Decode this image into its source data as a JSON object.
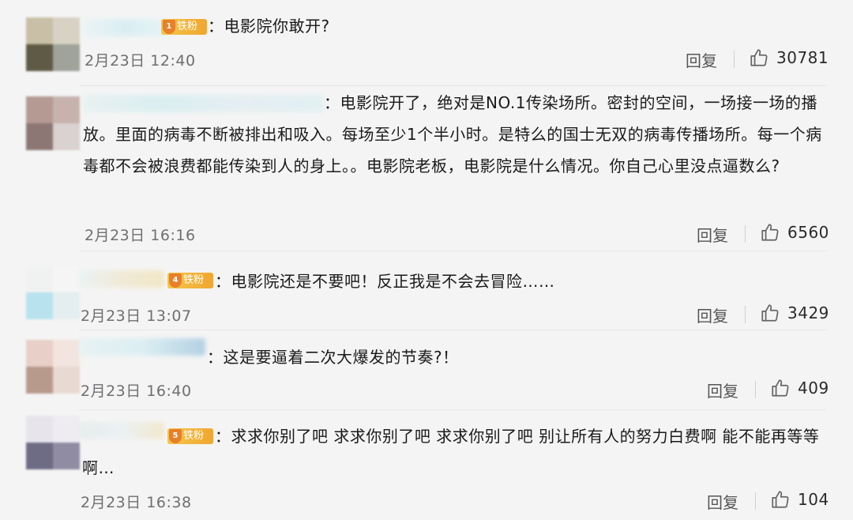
{
  "comments": [
    {
      "badge": "铁粉",
      "level": "1",
      "text": "：电影院你敢开?",
      "time": "2月23日 12:40",
      "reply": "回复",
      "likes": "30781"
    },
    {
      "badge": "",
      "level": "",
      "text": "：电影院开了，绝对是NO.1传染场所。密封的空间，一场接一场的播放。里面的病毒不断被排出和吸入。每场至少1个半小时。是特么的国士无双的病毒传播场所。每一个病毒都不会被浪费都能传染到人的身上。。电影院老板，电影院是什么情况。你自己心里没点逼数么?",
      "time": "2月23日 16:16",
      "reply": "回复",
      "likes": "6560"
    },
    {
      "badge": "铁粉",
      "level": "4",
      "text": "：电影院还是不要吧！反正我是不会去冒险……",
      "time": "2月23日 13:07",
      "reply": "回复",
      "likes": "3429"
    },
    {
      "badge": "",
      "level": "",
      "text": "：这是要逼着二次大爆发的节奏?！",
      "time": "2月23日 16:40",
      "reply": "回复",
      "likes": "409"
    },
    {
      "badge": "铁粉",
      "level": "5",
      "text": "：求求你别了吧 求求你别了吧 求求你别了吧 别让所有人的努力白费啊 能不能再等等啊…",
      "time": "2月23日 16:38",
      "reply": "回复",
      "likes": "104"
    }
  ],
  "icons": {
    "like": "thumbs-up-icon",
    "level": "level-crown-icon"
  },
  "colors": {
    "badge": "#f0a631",
    "time": "#6f6f6f",
    "background": "#f4f4f4"
  }
}
